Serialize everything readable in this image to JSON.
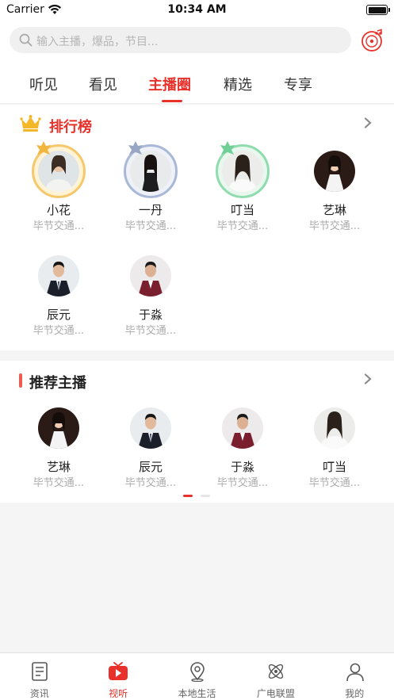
{
  "status_bar": {
    "carrier": "Carrier",
    "time": "10:34 AM"
  },
  "search": {
    "placeholder": "输入主播，爆品，节目..."
  },
  "tabs": [
    {
      "label": "听见",
      "active": false
    },
    {
      "label": "看见",
      "active": false
    },
    {
      "label": "主播圈",
      "active": true
    },
    {
      "label": "精选",
      "active": false
    },
    {
      "label": "专享",
      "active": false
    }
  ],
  "ranking": {
    "title": "排行榜",
    "anchors": [
      {
        "name": "小花",
        "org": "毕节交通...",
        "rank_color": "#f5c86b",
        "badge": "gold"
      },
      {
        "name": "一丹",
        "org": "毕节交通...",
        "rank_color": "#a9b8d6",
        "badge": "silver"
      },
      {
        "name": "叮当",
        "org": "毕节交通...",
        "rank_color": "#8fdcae",
        "badge": "green"
      },
      {
        "name": "艺琳",
        "org": "毕节交通...",
        "rank_color": "",
        "badge": ""
      },
      {
        "name": "辰元",
        "org": "毕节交通...",
        "rank_color": "",
        "badge": ""
      },
      {
        "name": "于淼",
        "org": "毕节交通...",
        "rank_color": "",
        "badge": ""
      }
    ]
  },
  "recommended": {
    "title": "推荐主播",
    "anchors": [
      {
        "name": "艺琳",
        "org": "毕节交通..."
      },
      {
        "name": "辰元",
        "org": "毕节交通..."
      },
      {
        "name": "于淼",
        "org": "毕节交通..."
      },
      {
        "name": "叮当",
        "org": "毕节交通..."
      }
    ],
    "pager": {
      "pages": 2,
      "current": 1
    }
  },
  "bottom_nav": [
    {
      "label": "资讯",
      "icon": "news-icon",
      "active": false
    },
    {
      "label": "视听",
      "icon": "video-play-icon",
      "active": true
    },
    {
      "label": "本地生活",
      "icon": "location-pin-icon",
      "active": false
    },
    {
      "label": "广电联盟",
      "icon": "atom-icon",
      "active": false
    },
    {
      "label": "我的",
      "icon": "person-icon",
      "active": false
    }
  ],
  "colors": {
    "accent": "#e8312a",
    "gold": "#f5c86b",
    "silver": "#a9b8d6",
    "green": "#8fdcae"
  }
}
